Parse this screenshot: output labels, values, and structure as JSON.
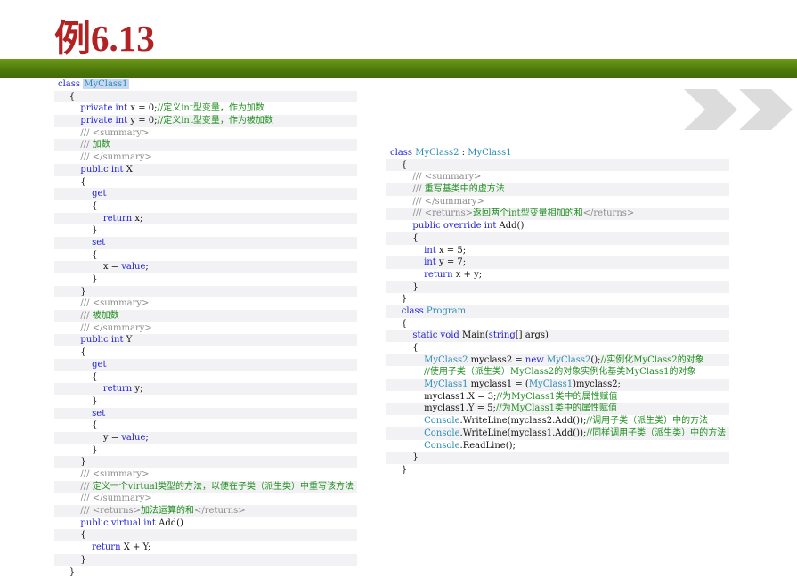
{
  "title": "例6.13",
  "colors": {
    "band": "#5a8a12",
    "title": "#b22222",
    "keyword": "#1f1fd6",
    "type": "#2b8bb5",
    "comment": "#1f8f1f",
    "chevron": "#dcdcdc"
  },
  "icons": [
    "double-chevron-right-icon"
  ],
  "left_code": [
    [
      [
        "kw",
        "class "
      ],
      [
        "ty",
        "MyClass1"
      ]
    ],
    [
      [
        "tx",
        "    {"
      ]
    ],
    [
      [
        "kw",
        "        private int "
      ],
      [
        "tx",
        "x = 0;"
      ],
      [
        "cm",
        "//定义int型变量，作为加数"
      ]
    ],
    [
      [
        "kw",
        "        private int "
      ],
      [
        "tx",
        "y = 0;"
      ],
      [
        "cm",
        "//定义int型变量，作为被加数"
      ]
    ],
    [
      [
        "xd",
        "        /// <summary>"
      ]
    ],
    [
      [
        "xd",
        "        /// "
      ],
      [
        "cm",
        "加数"
      ]
    ],
    [
      [
        "xd",
        "        /// </summary>"
      ]
    ],
    [
      [
        "kw",
        "        public int "
      ],
      [
        "tx",
        "X"
      ]
    ],
    [
      [
        "tx",
        "        {"
      ]
    ],
    [
      [
        "kw",
        "            get"
      ]
    ],
    [
      [
        "tx",
        "            {"
      ]
    ],
    [
      [
        "kw",
        "                return "
      ],
      [
        "tx",
        "x;"
      ]
    ],
    [
      [
        "tx",
        "            }"
      ]
    ],
    [
      [
        "kw",
        "            set"
      ]
    ],
    [
      [
        "tx",
        "            {"
      ]
    ],
    [
      [
        "tx",
        "                x = "
      ],
      [
        "kw",
        "value"
      ],
      [
        "tx",
        ";"
      ]
    ],
    [
      [
        "tx",
        "            }"
      ]
    ],
    [
      [
        "tx",
        "        }"
      ]
    ],
    [
      [
        "xd",
        "        /// <summary>"
      ]
    ],
    [
      [
        "xd",
        "        /// "
      ],
      [
        "cm",
        "被加数"
      ]
    ],
    [
      [
        "xd",
        "        /// </summary>"
      ]
    ],
    [
      [
        "kw",
        "        public int "
      ],
      [
        "tx",
        "Y"
      ]
    ],
    [
      [
        "tx",
        "        {"
      ]
    ],
    [
      [
        "kw",
        "            get"
      ]
    ],
    [
      [
        "tx",
        "            {"
      ]
    ],
    [
      [
        "kw",
        "                return "
      ],
      [
        "tx",
        "y;"
      ]
    ],
    [
      [
        "tx",
        "            }"
      ]
    ],
    [
      [
        "kw",
        "            set"
      ]
    ],
    [
      [
        "tx",
        "            {"
      ]
    ],
    [
      [
        "tx",
        "                y = "
      ],
      [
        "kw",
        "value"
      ],
      [
        "tx",
        ";"
      ]
    ],
    [
      [
        "tx",
        "            }"
      ]
    ],
    [
      [
        "tx",
        "        }"
      ]
    ],
    [
      [
        "xd",
        "        /// <summary>"
      ]
    ],
    [
      [
        "xd",
        "        /// "
      ],
      [
        "cm",
        "定义一个virtual类型的方法，以便在子类（派生类）中重写该方法"
      ]
    ],
    [
      [
        "xd",
        "        /// </summary>"
      ]
    ],
    [
      [
        "xd",
        "        /// <returns>"
      ],
      [
        "cm",
        "加法运算的和"
      ],
      [
        "xd",
        "</returns>"
      ]
    ],
    [
      [
        "kw",
        "        public virtual int "
      ],
      [
        "tx",
        "Add()"
      ]
    ],
    [
      [
        "tx",
        "        {"
      ]
    ],
    [
      [
        "kw",
        "            return "
      ],
      [
        "tx",
        "X + Y;"
      ]
    ],
    [
      [
        "tx",
        "        }"
      ]
    ],
    [
      [
        "tx",
        "    }"
      ]
    ]
  ],
  "right_code": [
    [
      [
        "kw",
        "class "
      ],
      [
        "ty",
        "MyClass2"
      ],
      [
        "tx",
        " : "
      ],
      [
        "ty",
        "MyClass1"
      ]
    ],
    [
      [
        "tx",
        "    {"
      ]
    ],
    [
      [
        "xd",
        "        /// <summary>"
      ]
    ],
    [
      [
        "xd",
        "        /// "
      ],
      [
        "cm",
        "重写基类中的虚方法"
      ]
    ],
    [
      [
        "xd",
        "        /// </summary>"
      ]
    ],
    [
      [
        "xd",
        "        /// <returns>"
      ],
      [
        "cm",
        "返回两个int型变量相加的和"
      ],
      [
        "xd",
        "</returns>"
      ]
    ],
    [
      [
        "kw",
        "        public override int "
      ],
      [
        "tx",
        "Add()"
      ]
    ],
    [
      [
        "tx",
        "        {"
      ]
    ],
    [
      [
        "kw",
        "            int "
      ],
      [
        "tx",
        "x = 5;"
      ]
    ],
    [
      [
        "kw",
        "            int "
      ],
      [
        "tx",
        "y = 7;"
      ]
    ],
    [
      [
        "kw",
        "            return "
      ],
      [
        "tx",
        "x + y;"
      ]
    ],
    [
      [
        "tx",
        "        }"
      ]
    ],
    [
      [
        "tx",
        "    }"
      ]
    ],
    [
      [
        "kw",
        "    class "
      ],
      [
        "ty",
        "Program"
      ]
    ],
    [
      [
        "tx",
        "    {"
      ]
    ],
    [
      [
        "kw",
        "        static void "
      ],
      [
        "tx",
        "Main("
      ],
      [
        "kw",
        "string"
      ],
      [
        "tx",
        "[] args)"
      ]
    ],
    [
      [
        "tx",
        "        {"
      ]
    ],
    [
      [
        "ty",
        "            MyClass2 "
      ],
      [
        "tx",
        "myclass2 = "
      ],
      [
        "kw",
        "new "
      ],
      [
        "ty",
        "MyClass2"
      ],
      [
        "tx",
        "();"
      ],
      [
        "cm",
        "//实例化MyClass2的对象"
      ]
    ],
    [
      [
        "cm",
        "            //使用子类（派生类）MyClass2的对象实例化基类MyClass1的对象"
      ]
    ],
    [
      [
        "ty",
        "            MyClass1 "
      ],
      [
        "tx",
        "myclass1 = ("
      ],
      [
        "ty",
        "MyClass1"
      ],
      [
        "tx",
        ")myclass2;"
      ]
    ],
    [
      [
        "tx",
        "            myclass1.X = 3;"
      ],
      [
        "cm",
        "//为MyClass1类中的属性赋值"
      ]
    ],
    [
      [
        "tx",
        "            myclass1.Y = 5;"
      ],
      [
        "cm",
        "//为MyClass1类中的属性赋值"
      ]
    ],
    [
      [
        "ty",
        "            Console"
      ],
      [
        "tx",
        ".WriteLine(myclass2.Add());"
      ],
      [
        "cm",
        "//调用子类（派生类）中的方法"
      ]
    ],
    [
      [
        "ty",
        "            Console"
      ],
      [
        "tx",
        ".WriteLine(myclass1.Add());"
      ],
      [
        "cm",
        "//同样调用子类（派生类）中的方法"
      ]
    ],
    [
      [
        "ty",
        "            Console"
      ],
      [
        "tx",
        ".ReadLine();"
      ]
    ],
    [
      [
        "tx",
        "        }"
      ]
    ],
    [
      [
        "tx",
        "    }"
      ]
    ]
  ]
}
